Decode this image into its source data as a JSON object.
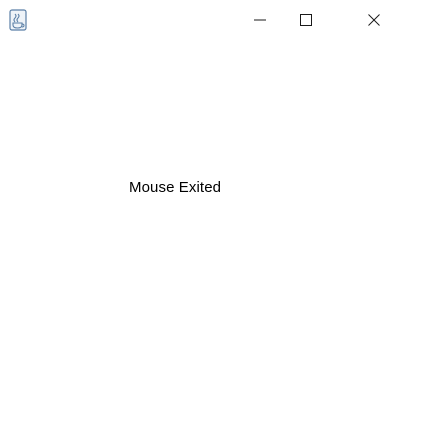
{
  "window": {
    "icon": "java-coffee-cup-icon",
    "controls": {
      "minimize_icon": "minimize-icon",
      "maximize_icon": "maximize-icon",
      "close_icon": "close-icon"
    }
  },
  "main": {
    "status_label": "Mouse Exited"
  },
  "colors": {
    "background": "#ffffff",
    "text": "#000000",
    "icon_stroke": "#1a1a1a",
    "app_icon_accent": "#5b7fa6"
  }
}
